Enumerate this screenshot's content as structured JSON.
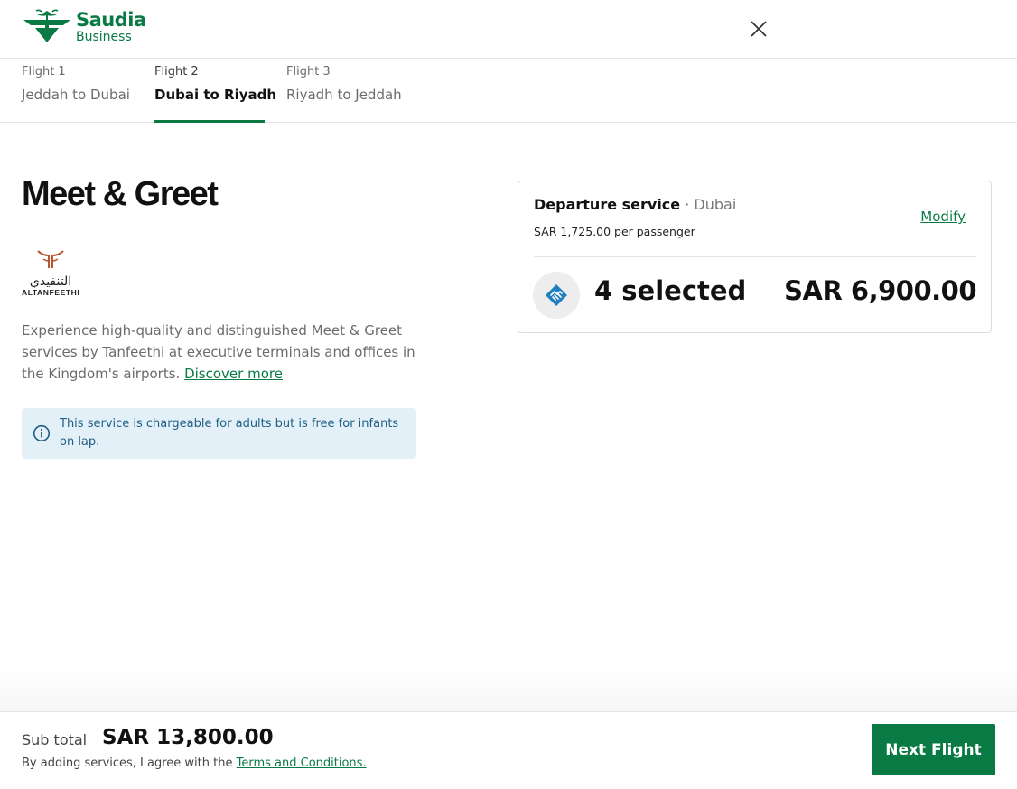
{
  "brand": {
    "name": "Saudia",
    "sub": "Business",
    "color": "#0a7a45"
  },
  "tabs": [
    {
      "number": "Flight 1",
      "route": "Jeddah to Dubai",
      "active": false
    },
    {
      "number": "Flight 2",
      "route": "Dubai to Riyadh",
      "active": true
    },
    {
      "number": "Flight 3",
      "route": "Riyadh to Jeddah",
      "active": false
    }
  ],
  "main": {
    "title": "Meet & Greet",
    "provider": {
      "arabic_name": "التنفيذي",
      "name": "ALTANFEETHI"
    },
    "description": "Experience high-quality and distinguished Meet & Greet services by Tanfeethi at executive terminals and offices in the Kingdom's airports.",
    "discover_link": "Discover more",
    "notice": "This service is chargeable for adults but is free for infants on lap."
  },
  "service_card": {
    "title": "Departure service",
    "separator": "·",
    "city": "Dubai",
    "price_per_passenger": "SAR 1,725.00 per passenger",
    "modify": "Modify",
    "selected": "4 selected",
    "total": "SAR 6,900.00"
  },
  "footer": {
    "subtotal_label": "Sub total",
    "subtotal_value": "SAR 13,800.00",
    "agree_text": "By adding services, I agree with the",
    "terms_link": "Terms and Conditions.",
    "next_button": "Next Flight"
  },
  "icons": {
    "logo": "saudia-palm-logo",
    "close": "close-icon",
    "info": "info-icon",
    "service": "handshake-icon"
  },
  "colors": {
    "accent": "#0a7a45",
    "notice_bg": "#e3f0f8",
    "notice_text": "#1f5f84",
    "provider_accent": "#b5562f",
    "service_icon": "#1f7fbf"
  }
}
